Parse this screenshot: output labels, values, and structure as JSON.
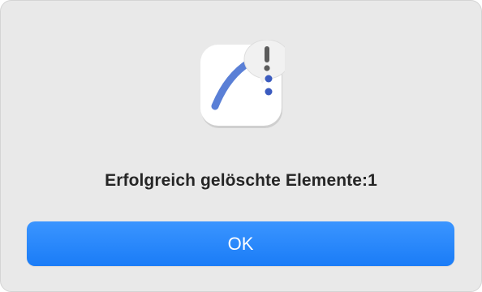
{
  "dialog": {
    "message": "Erfolgreich gelöschte Elemente:1",
    "ok_label": "OK"
  },
  "icons": {
    "app_icon": "app-icon-with-alert",
    "alert_badge": "exclamation-icon"
  },
  "colors": {
    "accent": "#1a7cf7",
    "background": "#e9e9e9",
    "text": "#262626",
    "stroke": "#5a7fd6"
  }
}
